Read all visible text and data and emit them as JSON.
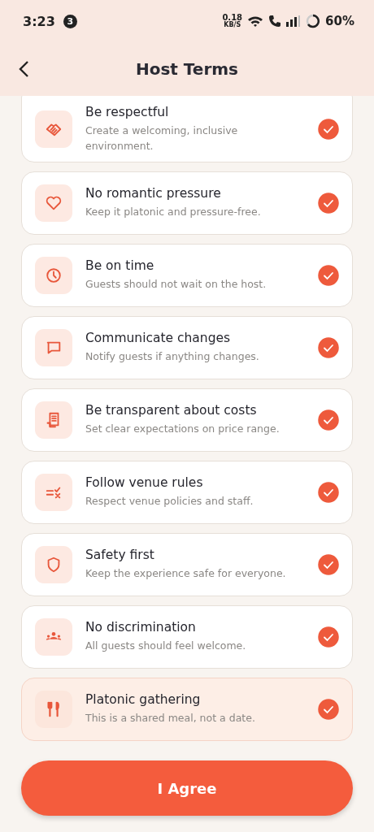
{
  "status_bar": {
    "time": "3:23",
    "notification_count": "3",
    "net_speed": "0.18",
    "net_unit": "KB/S",
    "battery": "60%"
  },
  "header": {
    "title": "Host Terms"
  },
  "terms": [
    {
      "title": "Be respectful",
      "description": "Create a welcoming, inclusive environment.",
      "checked": true,
      "highlighted": false
    },
    {
      "title": "No romantic pressure",
      "description": "Keep it platonic and pressure-free.",
      "checked": true,
      "highlighted": false
    },
    {
      "title": "Be on time",
      "description": "Guests should not wait on the host.",
      "checked": true,
      "highlighted": false
    },
    {
      "title": "Communicate changes",
      "description": "Notify guests if anything changes.",
      "checked": true,
      "highlighted": false
    },
    {
      "title": "Be transparent about costs",
      "description": "Set clear expectations on price range.",
      "checked": true,
      "highlighted": false
    },
    {
      "title": "Follow venue rules",
      "description": "Respect venue policies and staff.",
      "checked": true,
      "highlighted": false
    },
    {
      "title": "Safety first",
      "description": "Keep the experience safe for everyone.",
      "checked": true,
      "highlighted": false
    },
    {
      "title": "No discrimination",
      "description": "All guests should feel welcome.",
      "checked": true,
      "highlighted": false
    },
    {
      "title": "Platonic gathering",
      "description": "This is a shared meal, not a date.",
      "checked": true,
      "highlighted": true
    }
  ],
  "agree_button": {
    "label": "I Agree"
  }
}
